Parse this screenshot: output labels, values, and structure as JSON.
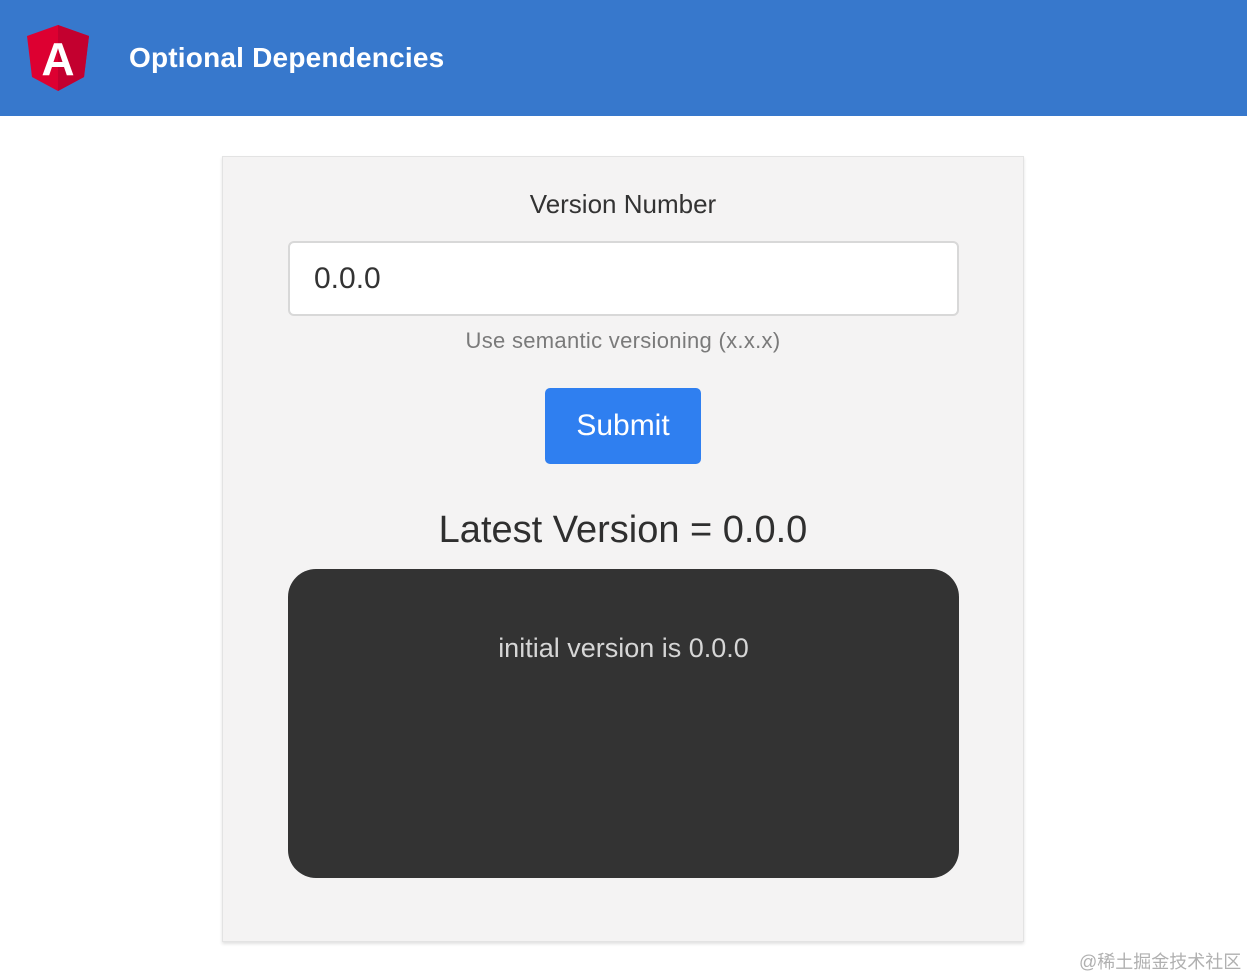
{
  "header": {
    "title": "Optional Dependencies",
    "logo_icon": "angular-logo-icon",
    "logo_letter": "A",
    "logo_color": "#dd0031",
    "background_color": "#3778cc"
  },
  "form": {
    "label": "Version Number",
    "input_value": "0.0.0",
    "hint": "Use semantic versioning (x.x.x)",
    "submit_label": "Submit",
    "button_color": "#2f7ff0"
  },
  "result": {
    "latest_text": "Latest Version = 0.0.0"
  },
  "log": {
    "lines": [
      "initial version is 0.0.0"
    ],
    "background_color": "#333333"
  },
  "watermark": {
    "text": "@稀土掘金技术社区"
  }
}
